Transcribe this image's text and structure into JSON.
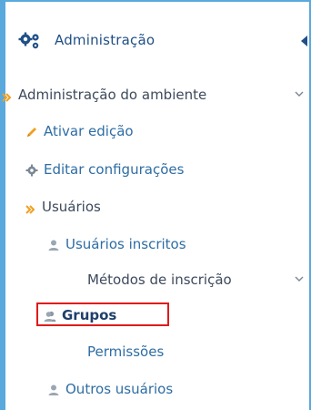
{
  "block": {
    "title": "Administração",
    "title_icon": "cogs-icon",
    "collapse_icon": "caret-left-icon"
  },
  "tree": {
    "admin_site": "Administração do ambiente",
    "activate_editing": "Ativar edição",
    "edit_settings": "Editar configurações",
    "users": "Usuários",
    "enrolled_users": "Usuários inscritos",
    "enrolment_methods": "Métodos de inscrição",
    "groups": "Grupos",
    "permissions": "Permissões",
    "other_users": "Outros usuários"
  },
  "colors": {
    "accent": "#5aa9dc",
    "highlight": "#e01a1a",
    "arrow_orange": "#f0a020"
  }
}
